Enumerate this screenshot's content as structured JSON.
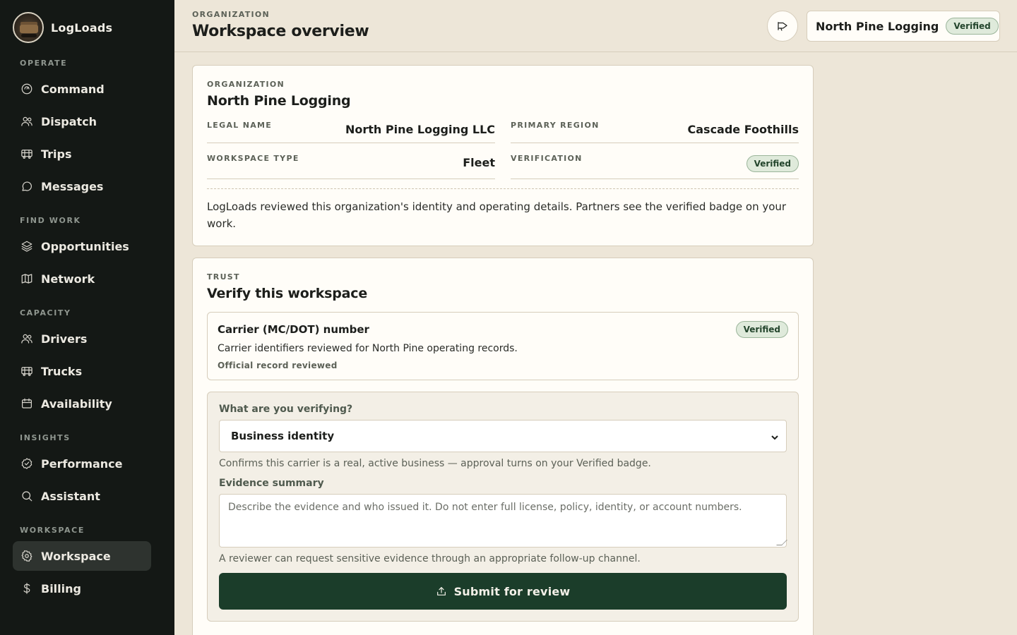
{
  "app": {
    "brand": "LogLoads"
  },
  "sidebar": {
    "sections": [
      {
        "label": "OPERATE"
      },
      {
        "label": "FIND WORK"
      },
      {
        "label": "CAPACITY"
      },
      {
        "label": "INSIGHTS"
      },
      {
        "label": "WORKSPACE"
      }
    ],
    "items": [
      {
        "label": "Command",
        "icon": "command-icon"
      },
      {
        "label": "Dispatch",
        "icon": "users-icon"
      },
      {
        "label": "Trips",
        "icon": "truck-icon"
      },
      {
        "label": "Messages",
        "icon": "message-icon"
      },
      {
        "label": "Opportunities",
        "icon": "layers-icon"
      },
      {
        "label": "Network",
        "icon": "map-icon"
      },
      {
        "label": "Drivers",
        "icon": "users-icon"
      },
      {
        "label": "Trucks",
        "icon": "truck-icon"
      },
      {
        "label": "Availability",
        "icon": "calendar-icon"
      },
      {
        "label": "Performance",
        "icon": "badge-check-icon"
      },
      {
        "label": "Assistant",
        "icon": "search-icon"
      },
      {
        "label": "Workspace",
        "icon": "gear-icon",
        "active": true
      },
      {
        "label": "Billing",
        "icon": "dollar-icon"
      }
    ]
  },
  "header": {
    "eyebrow": "ORGANIZATION",
    "title": "Workspace overview",
    "org_name": "North Pine Logging",
    "org_badge": "Verified"
  },
  "org_card": {
    "eyebrow": "ORGANIZATION",
    "title": "North Pine Logging",
    "fields": [
      {
        "label": "LEGAL NAME",
        "value": "North Pine Logging LLC"
      },
      {
        "label": "PRIMARY REGION",
        "value": "Cascade Foothills"
      },
      {
        "label": "WORKSPACE TYPE",
        "value": "Fleet"
      },
      {
        "label": "VERIFICATION",
        "value": "Verified"
      }
    ],
    "description": "LogLoads reviewed this organization's identity and operating details. Partners see the verified badge on your work."
  },
  "trust_card": {
    "eyebrow": "TRUST",
    "title": "Verify this workspace",
    "carrier": {
      "title": "Carrier (MC/DOT) number",
      "badge": "Verified",
      "description": "Carrier identifiers reviewed for North Pine operating records.",
      "status": "Official record reviewed"
    },
    "form": {
      "verify_label": "What are you verifying?",
      "verify_selected": "Business identity",
      "verify_hint": "Confirms this carrier is a real, active business — approval turns on your Verified badge.",
      "evidence_label": "Evidence summary",
      "evidence_placeholder": "Describe the evidence and who issued it. Do not enter full license, policy, identity, or account numbers.",
      "evidence_hint": "A reviewer can request sensitive evidence through an appropriate follow-up channel.",
      "submit_label": "Submit for review"
    }
  },
  "colors": {
    "sidebar_bg": "#141815",
    "page_bg": "#ede6d8",
    "accent": "#1b3d2a",
    "badge_bg": "#dfeadb"
  }
}
